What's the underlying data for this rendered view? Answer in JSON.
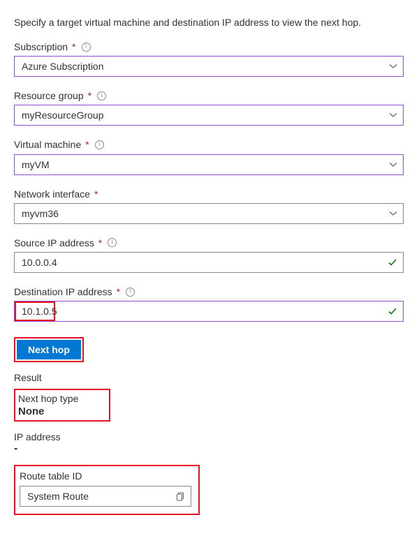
{
  "intro": "Specify a target virtual machine and destination IP address to view the next hop.",
  "fields": {
    "subscription": {
      "label": "Subscription",
      "value": "Azure Subscription"
    },
    "resourceGroup": {
      "label": "Resource group",
      "value": "myResourceGroup"
    },
    "virtualMachine": {
      "label": "Virtual machine",
      "value": "myVM"
    },
    "networkInterface": {
      "label": "Network interface",
      "value": "myvm36"
    },
    "sourceIp": {
      "label": "Source IP address",
      "value": "10.0.0.4"
    },
    "destinationIp": {
      "label": "Destination IP address",
      "value": "10.1.0.5"
    }
  },
  "requiredMark": "*",
  "button": {
    "nextHop": "Next hop"
  },
  "result": {
    "heading": "Result",
    "nextHopTypeLabel": "Next hop type",
    "nextHopTypeValue": "None",
    "ipAddressLabel": "IP address",
    "ipAddressValue": "-",
    "routeTableLabel": "Route table ID",
    "routeTableValue": "System Route"
  }
}
